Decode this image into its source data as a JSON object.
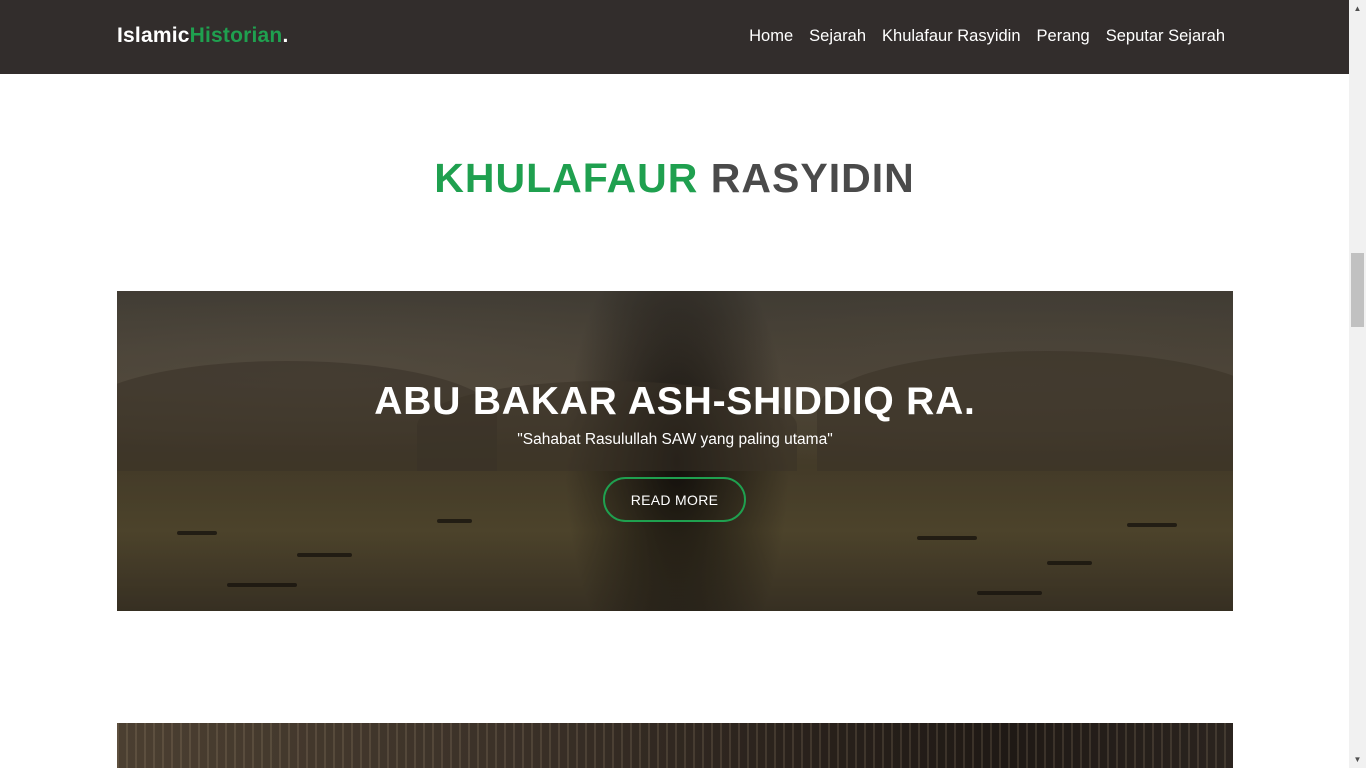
{
  "navbar": {
    "brand": {
      "part1": "Islamic",
      "part2": "Historian",
      "dot": "."
    },
    "items": [
      {
        "label": "Home"
      },
      {
        "label": "Sejarah"
      },
      {
        "label": "Khulafaur Rasyidin"
      },
      {
        "label": "Perang"
      },
      {
        "label": "Seputar Sejarah"
      }
    ]
  },
  "section": {
    "title_accent": "KHULAFAUR",
    "title_rest": " RASYIDIN"
  },
  "cards": [
    {
      "title": "ABU BAKAR ASH-SHIDDIQ RA.",
      "quote": "\"Sahabat Rasulullah SAW yang paling utama\"",
      "button_label": "READ MORE"
    }
  ],
  "colors": {
    "accent": "#1fa04f",
    "navbar_bg": "#322d2c",
    "heading_gray": "#4a4a4a"
  },
  "icons": {
    "scroll_up": "▲",
    "scroll_down": "▼"
  }
}
